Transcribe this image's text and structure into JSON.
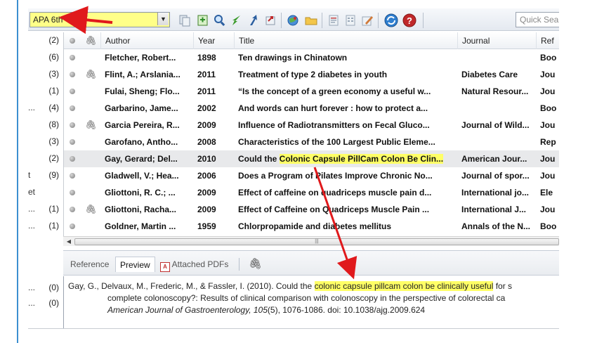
{
  "toolbar": {
    "style_value": "APA 6th",
    "quick_search_placeholder": "Quick Sea",
    "icons": [
      "copy-icon",
      "new-reference-icon",
      "find-icon",
      "import-icon",
      "export-icon",
      "open-link-icon",
      "online-search-icon",
      "folder-icon",
      "insert-citation-icon",
      "format-bibliography-icon",
      "edit-icon",
      "sync-icon",
      "help-icon"
    ]
  },
  "groups": [
    {
      "label": "",
      "count": "(2)"
    },
    {
      "label": "",
      "count": "(6)"
    },
    {
      "label": "",
      "count": "(3)"
    },
    {
      "label": "",
      "count": "(1)"
    },
    {
      "label": "...",
      "count": "(4)"
    },
    {
      "label": "",
      "count": "(8)"
    },
    {
      "label": "",
      "count": "(3)"
    },
    {
      "label": "",
      "count": "(2)"
    },
    {
      "label": "t",
      "count": "(9)"
    },
    {
      "label": "et",
      "count": ""
    },
    {
      "label": "...",
      "count": "(1)"
    },
    {
      "label": "...",
      "count": "(1)"
    }
  ],
  "table": {
    "columns": [
      "Author",
      "Year",
      "Title",
      "Journal",
      "Ref"
    ],
    "rows": [
      {
        "attach": false,
        "author": "Fletcher, Robert...",
        "year": "1898",
        "title": "Ten drawings in Chinatown",
        "journal": "",
        "ref": "Boo"
      },
      {
        "attach": true,
        "author": "Flint, A.; Arslania...",
        "year": "2011",
        "title": "Treatment of type 2 diabetes in youth",
        "journal": "Diabetes Care",
        "ref": "Jou"
      },
      {
        "attach": false,
        "author": "Fulai, Sheng; Flo...",
        "year": "2011",
        "title": "“Is the concept of a green economy a useful w...",
        "journal": "Natural Resour...",
        "ref": "Jou"
      },
      {
        "attach": false,
        "author": "Garbarino, Jame...",
        "year": "2002",
        "title": "And words can hurt forever : how to protect a...",
        "journal": "",
        "ref": "Boo"
      },
      {
        "attach": true,
        "author": "Garcia Pereira, R...",
        "year": "2009",
        "title": "Influence of Radiotransmitters on Fecal Gluco...",
        "journal": "Journal of Wild...",
        "ref": "Jou"
      },
      {
        "attach": false,
        "author": "Garofano, Antho...",
        "year": "2008",
        "title": "Characteristics of the 100 Largest Public Eleme...",
        "journal": "",
        "ref": "Rep"
      },
      {
        "attach": false,
        "author": "Gay, Gerard; Del...",
        "year": "2010",
        "title_pre": "Could the ",
        "title_hl": "Colonic Capsule PillCam Colon Be Clin...",
        "journal": "American Jour...",
        "ref": "Jou",
        "selected": true
      },
      {
        "attach": false,
        "author": "Gladwell, V.; Hea...",
        "year": "2006",
        "title": "Does a Program of Pilates Improve Chronic No...",
        "journal": "Journal of spor...",
        "ref": "Jou"
      },
      {
        "attach": false,
        "author": "Gliottoni, R. C.; ...",
        "year": "2009",
        "title": "Effect of caffeine on quadriceps muscle pain d...",
        "journal": "International jo...",
        "ref": "Ele"
      },
      {
        "attach": true,
        "author": "Gliottoni, Racha...",
        "year": "2009",
        "title": "Effect of Caffeine on Quadriceps Muscle Pain ...",
        "journal": "International J...",
        "ref": "Jou"
      },
      {
        "attach": false,
        "author": "Goldner, Martin ...",
        "year": "1959",
        "title": "Chlorpropamide and diabetes mellitus",
        "journal": "Annals of the N...",
        "ref": "Boo"
      }
    ]
  },
  "tabs": {
    "reference": "Reference",
    "preview": "Preview",
    "attached_pdfs": "Attached PDFs"
  },
  "preview": {
    "line1_pre": "Gay, G., Delvaux, M., Frederic, M., & Fassler, I. (2010). Could the ",
    "line1_hl": "colonic capsule pillcam colon be clinically useful",
    "line1_post": " for s",
    "line2": "complete colonoscopy?: Results of clinical comparison with colonoscopy in the perspective of colorectal ca",
    "line3_journal": "American Journal of Gastroenterology, 105",
    "line3_rest": "(5), 1076-1086. doi: 10.1038/ajg.2009.624",
    "counts": [
      "(0)",
      "(0)"
    ],
    "count_labels": [
      "...",
      "..."
    ]
  },
  "colors": {
    "highlight": "#ffff66",
    "arrow": "#e0191c",
    "accent_border": "#3c8fd0"
  }
}
